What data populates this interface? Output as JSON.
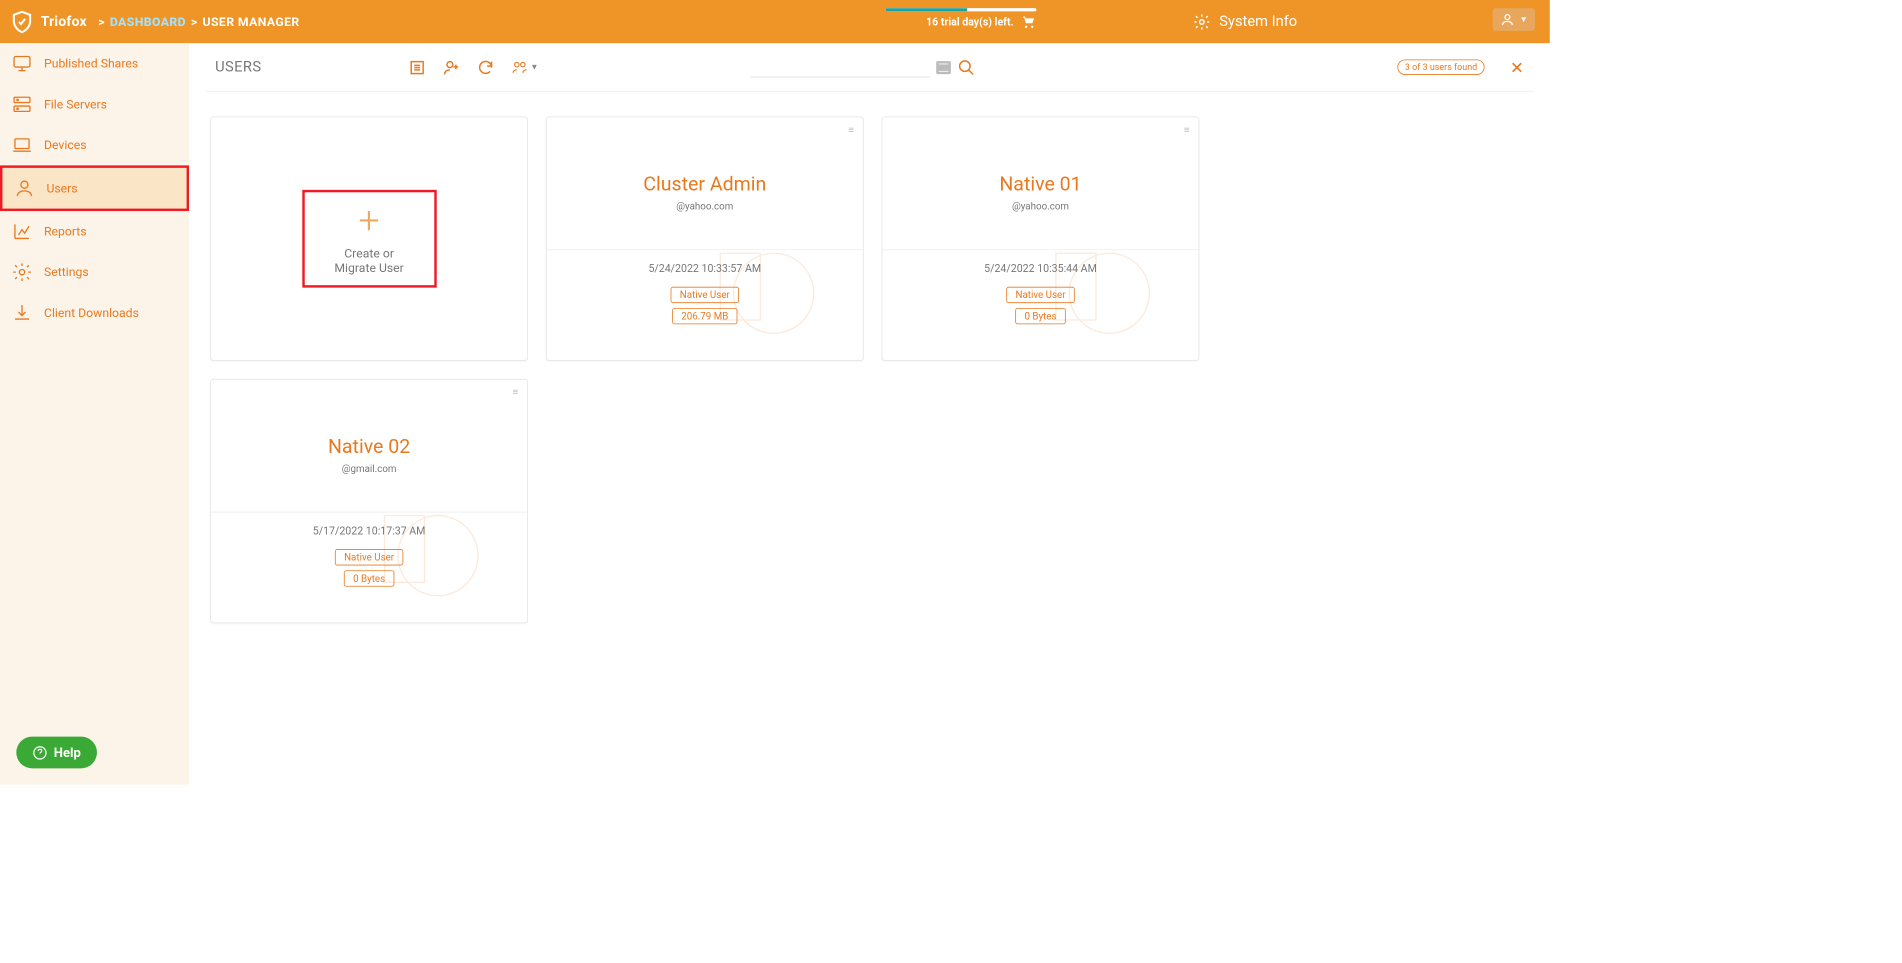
{
  "header": {
    "brand": "Triofox",
    "crumb_sep": ">",
    "crumb_dashboard": "DASHBOARD",
    "crumb_current": "USER MANAGER",
    "trial_text": "16 trial day(s) left.",
    "sysinfo_label": "System Info"
  },
  "sidebar": {
    "items": [
      {
        "label": "Published Shares"
      },
      {
        "label": "File Servers"
      },
      {
        "label": "Devices"
      },
      {
        "label": "Users"
      },
      {
        "label": "Reports"
      },
      {
        "label": "Settings"
      },
      {
        "label": "Client Downloads"
      }
    ],
    "help_label": "Help"
  },
  "content": {
    "title": "USERS",
    "count_pill": "3 of 3 users found",
    "create_label": "Create or Migrate User",
    "users": [
      {
        "name": "Cluster Admin",
        "email": "@yahoo.com",
        "datetime": "5/24/2022 10:33:57 AM",
        "user_type": "Native User",
        "storage": "206.79 MB"
      },
      {
        "name": "Native 01",
        "email": "@yahoo.com",
        "datetime": "5/24/2022 10:35:44 AM",
        "user_type": "Native User",
        "storage": "0 Bytes"
      },
      {
        "name": "Native 02",
        "email": "@gmail.com",
        "datetime": "5/17/2022 10:17:37 AM",
        "user_type": "Native User",
        "storage": "0 Bytes"
      }
    ]
  }
}
